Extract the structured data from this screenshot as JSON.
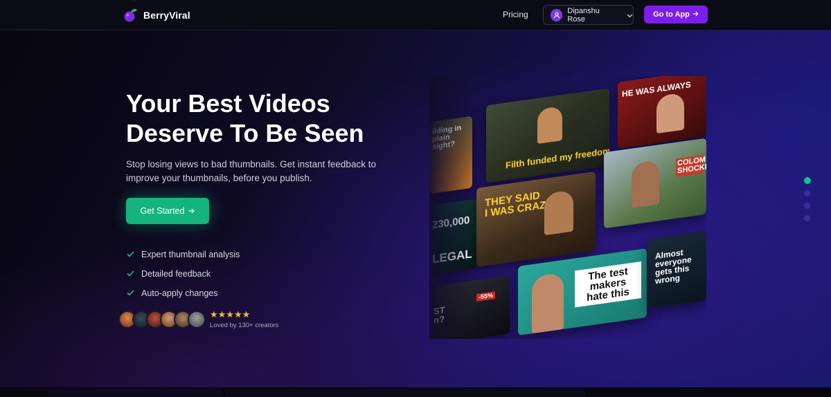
{
  "navbar": {
    "brand": "BerryViral",
    "pricing": "Pricing",
    "user_name": "Dipanshu Rose",
    "go_to_app": "Go to App"
  },
  "hero": {
    "title_line1": "Your Best Videos",
    "title_line2": "Deserve To Be Seen",
    "subtitle": "Stop losing views to bad thumbnails. Get instant feedback to improve your thumbnails, before you publish.",
    "cta": "Get Started",
    "features": [
      "Expert thumbnail analysis",
      "Detailed feedback",
      "Auto-apply changes"
    ],
    "stars": "★★★★★",
    "rating": 5,
    "social_proof": "Loved by 130+ creators"
  },
  "thumbnails": {
    "t1": "ilding in plain sight?",
    "t2": "Filth funded my freedom",
    "t3": "HE WAS ALWAYS",
    "t4": "230,000",
    "t5": "LEGAL",
    "t6_line1": "THEY SAID",
    "t6_line2": "I WAS CRAZY",
    "t7": "COLOM SHOCKE",
    "t8_line1": "The test",
    "t8_line2": "makers",
    "t8_line3": "hate this",
    "t9": "Almost everyone gets this wrong",
    "t10": "-55%",
    "t11": "ST n?"
  },
  "carousel": {
    "active_index": 0,
    "count": 4
  },
  "colors": {
    "accent_purple": "#7c1ee8",
    "cta_green": "#15b37e",
    "star_yellow": "#f5c02c"
  }
}
